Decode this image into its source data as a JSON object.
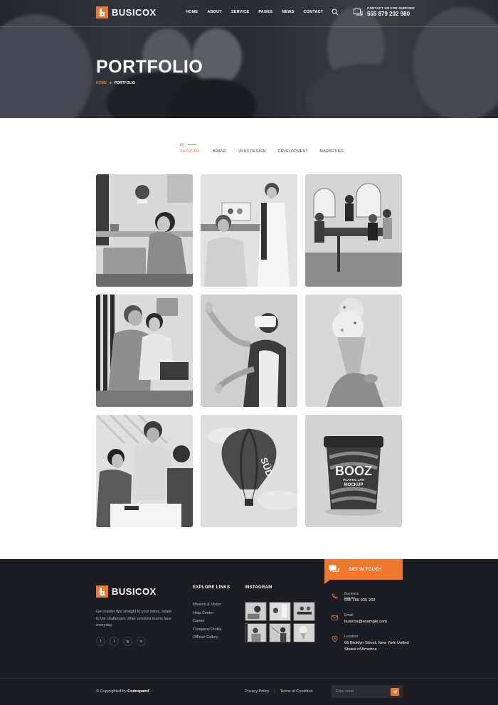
{
  "brand": {
    "name": "BUSICOX",
    "accent": "#f0782e"
  },
  "nav": {
    "items": [
      "HOME",
      "ABOUT",
      "SERVICE",
      "PAGES",
      "NEWS",
      "CONTACT"
    ],
    "support_label": "CONTACT US FOR SUPPORT",
    "support_phone": "555 879 202 980"
  },
  "hero": {
    "title": "PORTFOLIO",
    "breadcrumb_home": "HOME",
    "breadcrumb_sep": "»",
    "breadcrumb_current": "PORTFOLIO"
  },
  "filter": {
    "count": "[9]",
    "tabs": [
      "SHOW ALL",
      "BRAND",
      "UI/UX DESIGN",
      "DEVELOPMENT",
      "MARKETING"
    ]
  },
  "portfolio": {
    "items": [
      "woman-laptop",
      "office-team-standing",
      "meeting-room",
      "colleagues-laptop",
      "vr-headset-woman",
      "ice-cream-cone",
      "team-blueprint",
      "hot-air-balloon",
      "booz-cup-mockup"
    ],
    "balloon_text": "SÜD",
    "mockup_title": "BOOZ",
    "mockup_sub1": "PLASTIC JAR",
    "mockup_sub2": "MOCKUP"
  },
  "footer": {
    "get_in_touch": "GET IN TOUCH",
    "about_text": "Get insider tips straight to your inbox, relate to the challenges other services teams face everyday.",
    "socials": [
      "f",
      "t",
      "ig",
      "in"
    ],
    "explore_title": "EXPLORE LINKS",
    "explore_links": [
      "Mission & Vision",
      "Help Center",
      "Career",
      "Company Profile",
      "Official Gallery"
    ],
    "instagram_title": "INSTAGRAM",
    "contact": [
      {
        "label": "Business Inquiry",
        "value": "555 780 935 202"
      },
      {
        "label": "Email",
        "value": "busicox@example.com"
      },
      {
        "label": "Location",
        "value": "66 Broklyn Street, New York United States of America"
      }
    ],
    "copyright_prefix": "© Copyrighted by ",
    "copyright_brand": "Codexpand",
    "privacy": "Privacy Policy",
    "legal_sep": "|",
    "terms": "Terms of Condition",
    "email_placeholder": "Enter email"
  }
}
